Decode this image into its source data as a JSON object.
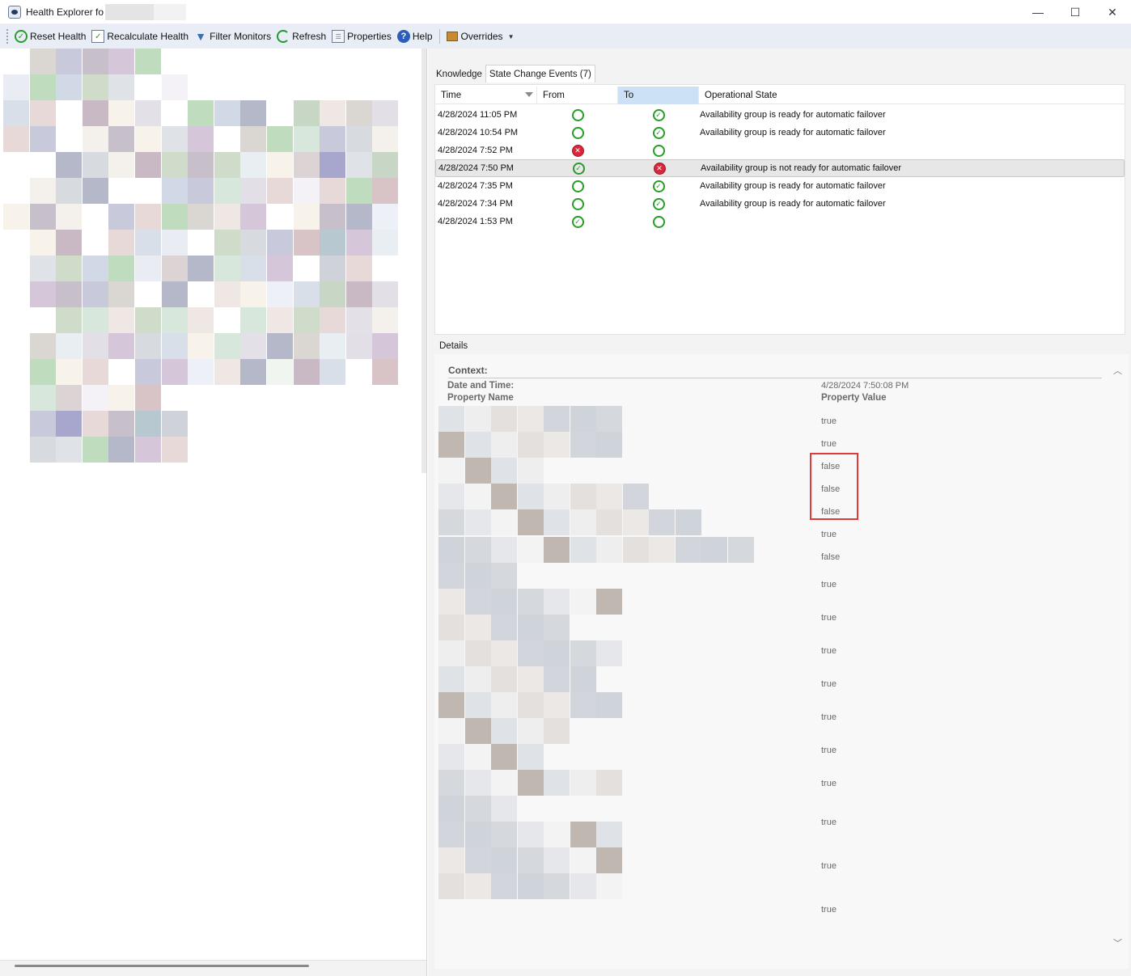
{
  "window": {
    "title": "Health Explorer fo",
    "minimize": "—",
    "maximize": "☐",
    "close": "✕"
  },
  "toolbar": {
    "reset_health": "Reset Health",
    "recalculate_health": "Recalculate Health",
    "filter_monitors": "Filter Monitors",
    "refresh": "Refresh",
    "properties": "Properties",
    "help": "Help",
    "overrides": "Overrides"
  },
  "tabs": {
    "knowledge": "Knowledge",
    "state_change_events": "State Change Events (7)"
  },
  "grid": {
    "headers": {
      "time": "Time",
      "from": "From",
      "to": "To",
      "operational_state": "Operational State"
    },
    "rows": [
      {
        "time": "4/28/2024 11:05 PM",
        "from": "empty",
        "to": "ok",
        "state": "Availability group is ready for automatic failover"
      },
      {
        "time": "4/28/2024 10:54 PM",
        "from": "empty",
        "to": "ok",
        "state": "Availability group is ready for automatic failover"
      },
      {
        "time": "4/28/2024 7:52 PM",
        "from": "err",
        "to": "empty",
        "state": ""
      },
      {
        "time": "4/28/2024 7:50 PM",
        "from": "ok",
        "to": "err",
        "state": "Availability group is not ready for automatic failover"
      },
      {
        "time": "4/28/2024 7:35 PM",
        "from": "empty",
        "to": "ok",
        "state": "Availability group is ready for automatic failover"
      },
      {
        "time": "4/28/2024 7:34 PM",
        "from": "empty",
        "to": "ok",
        "state": "Availability group is ready for automatic failover"
      },
      {
        "time": "4/28/2024 1:53 PM",
        "from": "ok",
        "to": "empty",
        "state": ""
      }
    ]
  },
  "details": {
    "label": "Details",
    "context_title": "Context:",
    "date_time_label": "Date and Time:",
    "date_time_value": "4/28/2024 7:50:08 PM",
    "property_name_header": "Property Name",
    "property_value_header": "Property Value",
    "values": [
      "true",
      "true",
      "false",
      "false",
      "false",
      "true",
      "false",
      "true",
      "true",
      "true",
      "true",
      "true",
      "true",
      "true",
      "true",
      "true",
      "true"
    ]
  },
  "colors": {
    "toolbar_bg": "#e9eef6",
    "sorted_header": "#cce1f5",
    "ok_green": "#2a9a2a",
    "error_red": "#d8263a",
    "highlight_box": "#e0393b"
  }
}
